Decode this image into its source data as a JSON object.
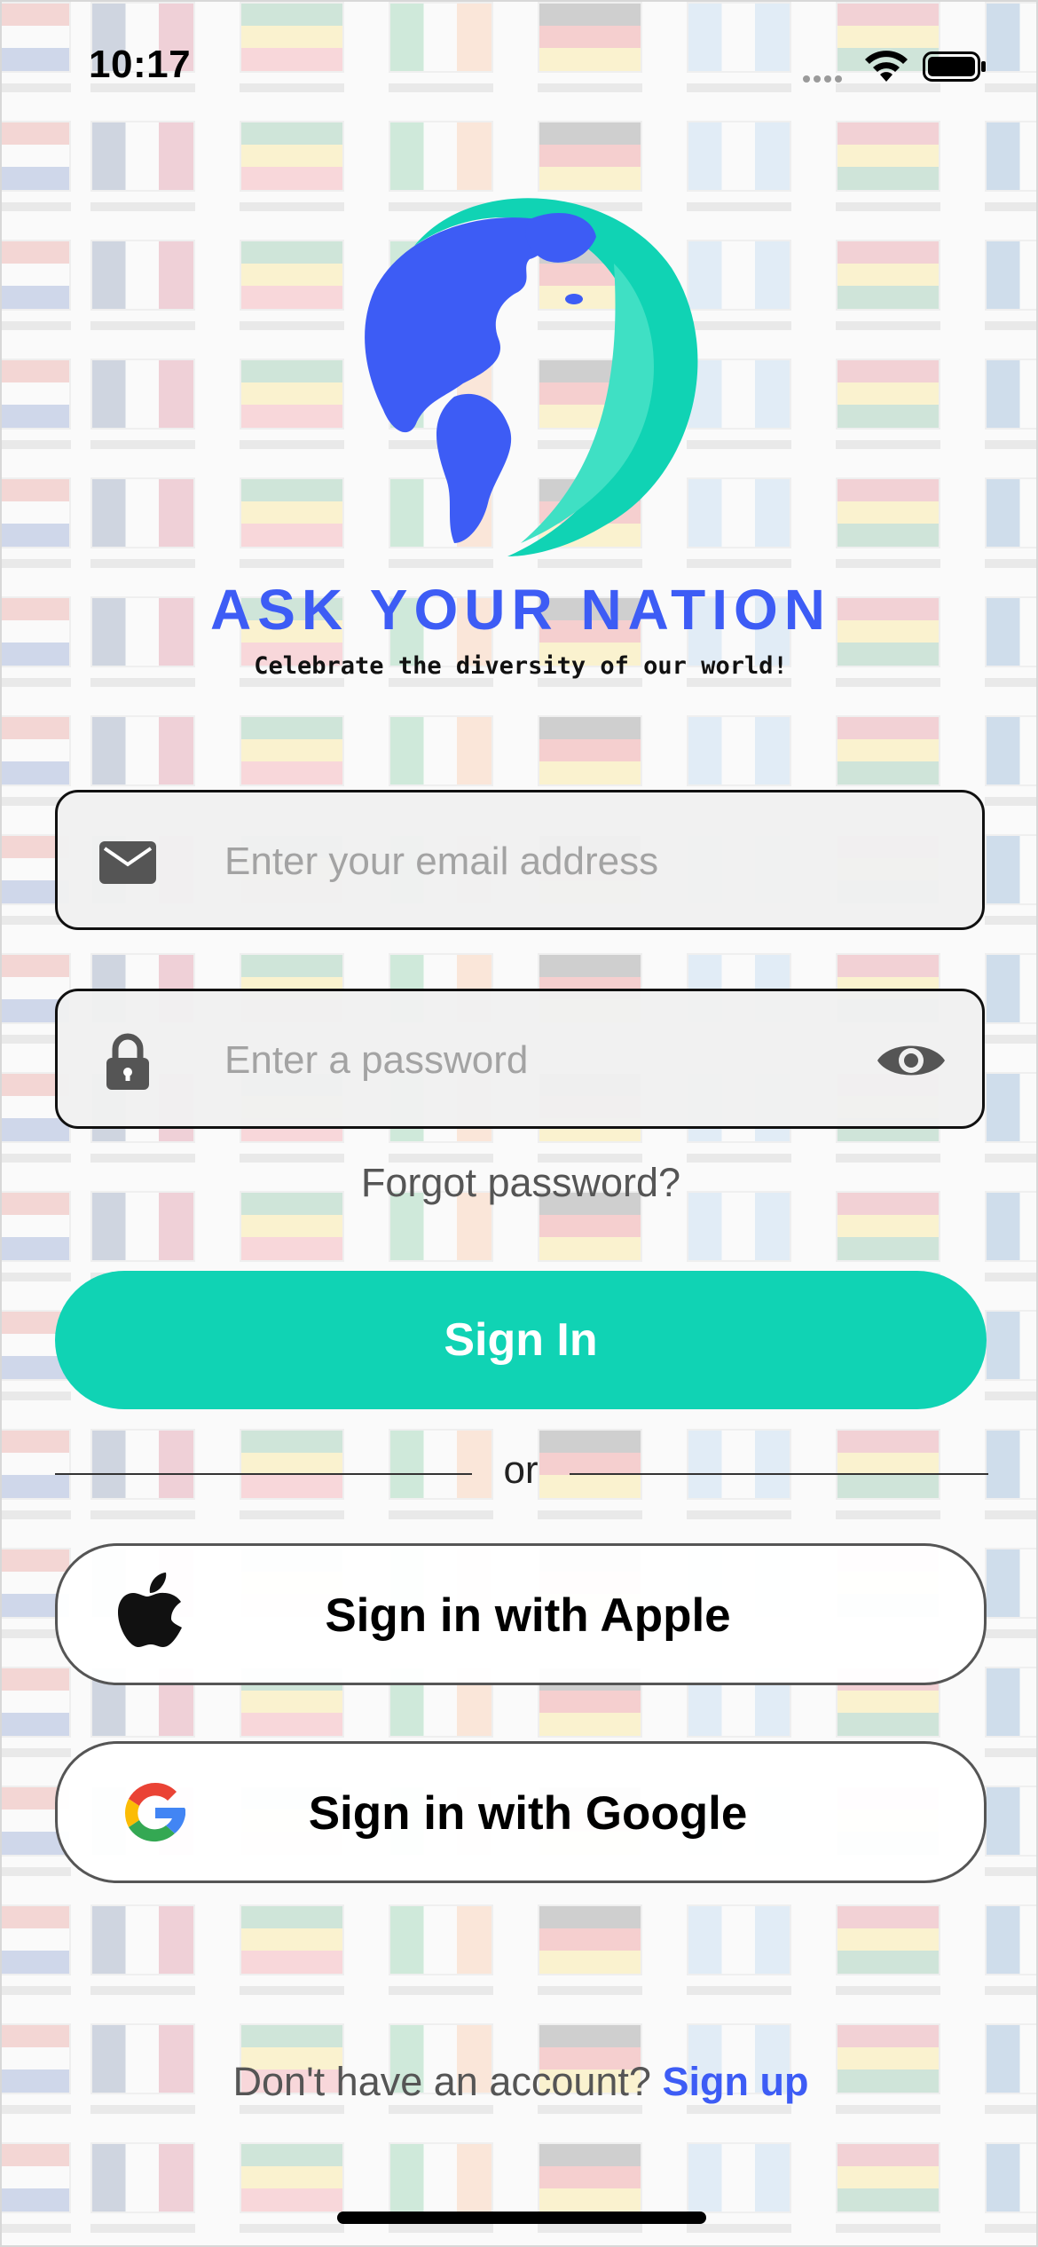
{
  "status_bar": {
    "time": "10:17"
  },
  "brand": {
    "name": "ASK YOUR NATION",
    "tagline": "Celebrate the diversity of our world!",
    "logo_icon": "globe-leaf-logo"
  },
  "email": {
    "placeholder": "Enter your email address",
    "value": "",
    "icon": "envelope-icon"
  },
  "password": {
    "placeholder": "Enter a password",
    "value": "",
    "icon": "lock-icon",
    "toggle_icon": "eye-icon"
  },
  "forgot_label": "Forgot password?",
  "signin_label": "Sign In",
  "or_label": "or",
  "apple": {
    "label": "Sign in with Apple",
    "icon": "apple-icon"
  },
  "google": {
    "label": "Sign in with Google",
    "icon": "google-icon"
  },
  "signup": {
    "prompt": "Don't have an account?",
    "link": "Sign up"
  },
  "colors": {
    "accent": "#10d3b4",
    "brand_blue": "#3d5cf5",
    "field_bg": "#f0f0f0"
  }
}
